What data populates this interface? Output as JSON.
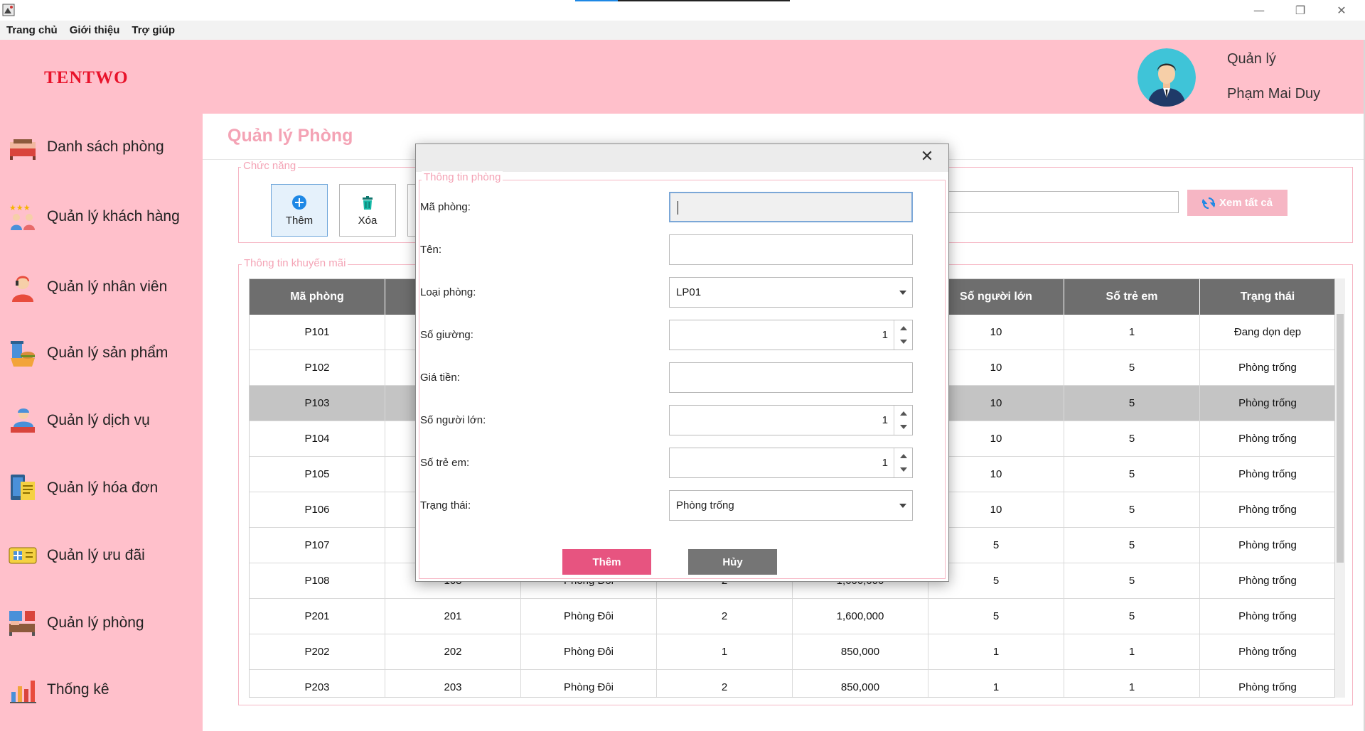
{
  "menu": [
    "Trang chủ",
    "Giới thiệu",
    "Trợ giúp"
  ],
  "window_controls": {
    "minimize": "—",
    "maximize": "❐",
    "close": "✕"
  },
  "brand": "TENTWO",
  "user": {
    "role": "Quản lý",
    "name": "Phạm Mai Duy"
  },
  "sidebar": {
    "items": [
      {
        "label": "Danh sách phòng",
        "icon": "bed-icon"
      },
      {
        "label": "Quản lý khách hàng",
        "icon": "customers-stars-icon"
      },
      {
        "label": "Quản lý nhân viên",
        "icon": "staff-headset-icon"
      },
      {
        "label": "Quản lý sản phẩm",
        "icon": "food-drink-icon"
      },
      {
        "label": "Quản lý dịch vụ",
        "icon": "service-icon"
      },
      {
        "label": "Quản lý hóa đơn",
        "icon": "invoice-icon"
      },
      {
        "label": "Quản lý ưu đãi",
        "icon": "voucher-icon"
      },
      {
        "label": "Quản lý phòng",
        "icon": "room-icon"
      },
      {
        "label": "Thống kê",
        "icon": "bar-chart-icon"
      }
    ]
  },
  "main": {
    "title": "Quản lý Phòng",
    "function_group_label": "Chức năng",
    "buttons": {
      "add": "Thêm",
      "delete": "Xóa",
      "view_all": "Xem tất cả"
    },
    "table_group_label": "Thông tin khuyến mãi",
    "table": {
      "columns": [
        "Mã phòng",
        "",
        "",
        "",
        "",
        "Số người lớn",
        "Số trẻ em",
        "Trạng thái"
      ],
      "rows": [
        [
          "P101",
          "",
          "",
          "",
          "",
          "10",
          "1",
          "Đang dọn dẹp"
        ],
        [
          "P102",
          "",
          "",
          "",
          "",
          "10",
          "5",
          "Phòng trống"
        ],
        [
          "P103",
          "",
          "",
          "",
          "",
          "10",
          "5",
          "Phòng trống"
        ],
        [
          "P104",
          "",
          "",
          "",
          "",
          "10",
          "5",
          "Phòng trống"
        ],
        [
          "P105",
          "",
          "",
          "",
          "",
          "10",
          "5",
          "Phòng trống"
        ],
        [
          "P106",
          "",
          "",
          "",
          "",
          "10",
          "5",
          "Phòng trống"
        ],
        [
          "P107",
          "",
          "",
          "",
          "",
          "5",
          "5",
          "Phòng trống"
        ],
        [
          "P108",
          "108",
          "Phòng Đôi",
          "2",
          "1,600,000",
          "5",
          "5",
          "Phòng trống"
        ],
        [
          "P201",
          "201",
          "Phòng Đôi",
          "2",
          "1,600,000",
          "5",
          "5",
          "Phòng trống"
        ],
        [
          "P202",
          "202",
          "Phòng Đôi",
          "1",
          "850,000",
          "1",
          "1",
          "Phòng trống"
        ],
        [
          "P203",
          "203",
          "Phòng Đôi",
          "2",
          "850,000",
          "1",
          "1",
          "Phòng trống"
        ]
      ],
      "selected_row": 2
    }
  },
  "dialog": {
    "group_label": "Thông tin phòng",
    "fields": {
      "ma_phong": {
        "label": "Mã phòng:",
        "value": ""
      },
      "ten": {
        "label": "Tên:",
        "value": ""
      },
      "loai_phong": {
        "label": "Loại phòng:",
        "value": "LP01"
      },
      "so_giuong": {
        "label": "Số giường:",
        "value": "1"
      },
      "gia_tien": {
        "label": "Giá tiền:",
        "value": ""
      },
      "so_nguoi_lon": {
        "label": "Số người lớn:",
        "value": "1"
      },
      "so_tre_em": {
        "label": "Số trẻ em:",
        "value": "1"
      },
      "trang_thai": {
        "label": "Trạng thái:",
        "value": "Phòng trống"
      }
    },
    "buttons": {
      "add": "Thêm",
      "cancel": "Hủy"
    }
  },
  "colors": {
    "sidebar_bg": "#ffc0cb",
    "brand": "#e8132b",
    "title_pink": "#f4a3b5",
    "table_header": "#6e6e6e",
    "dialog_add": "#e75480",
    "dialog_cancel": "#757575"
  }
}
